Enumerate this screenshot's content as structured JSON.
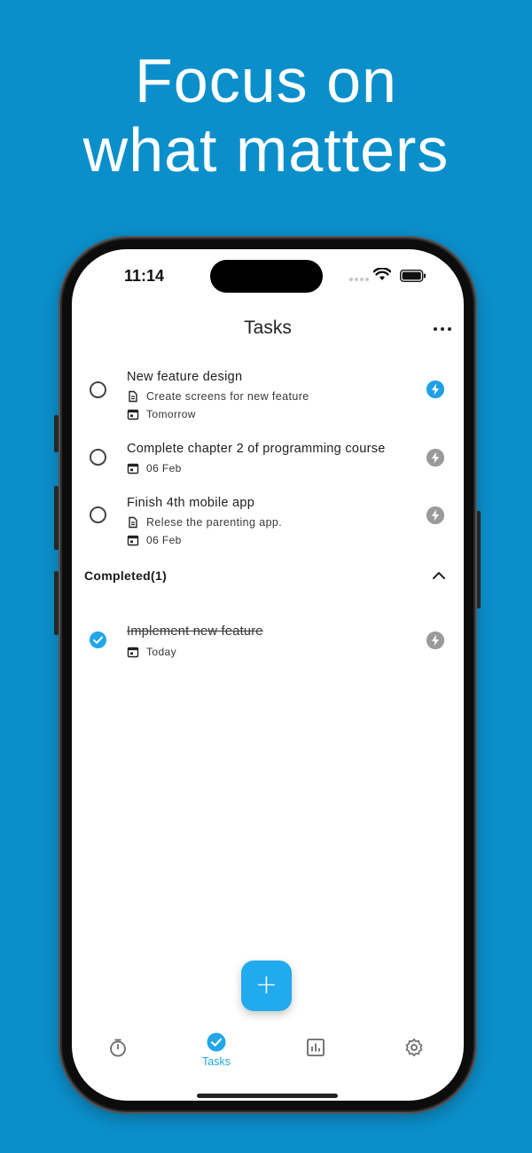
{
  "headline": {
    "line1": "Focus on",
    "line2": "what matters"
  },
  "status_bar": {
    "time": "11:14"
  },
  "header": {
    "title": "Tasks",
    "more_icon": "more-horizontal-icon"
  },
  "tasks": [
    {
      "title": "New feature design",
      "note": "Create screens for new feature",
      "date": "Tomorrow",
      "priority_active": true
    },
    {
      "title": "Complete chapter 2 of programming course",
      "note": "",
      "date": "06 Feb",
      "priority_active": false
    },
    {
      "title": "Finish 4th mobile app",
      "note": "Relese the parenting app.",
      "date": "06 Feb",
      "priority_active": false
    }
  ],
  "completed": {
    "label": "Completed(1)",
    "expanded": true,
    "items": [
      {
        "title": "Implement new feature",
        "date": "Today",
        "priority_active": false
      }
    ]
  },
  "fab": {
    "label": "+"
  },
  "bottom_nav": {
    "items": [
      {
        "icon": "timer-icon",
        "label": ""
      },
      {
        "icon": "check-circle-icon",
        "label": "Tasks",
        "active": true
      },
      {
        "icon": "bar-chart-icon",
        "label": ""
      },
      {
        "icon": "gear-icon",
        "label": ""
      }
    ]
  },
  "colors": {
    "background": "#0b8fcb",
    "accent": "#21a6e8",
    "inactive_icon": "#9a9a9a"
  }
}
